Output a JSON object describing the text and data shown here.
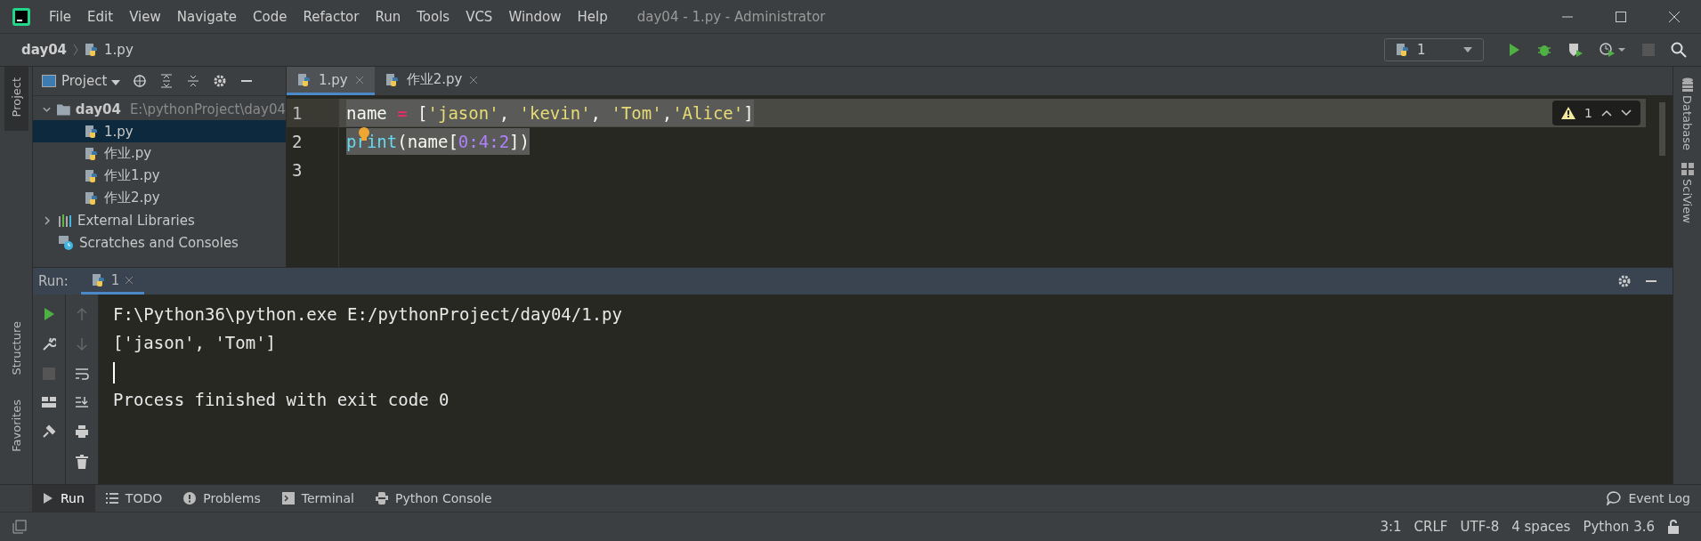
{
  "window": {
    "title": "day04 - 1.py - Administrator"
  },
  "menu": [
    "File",
    "Edit",
    "View",
    "Navigate",
    "Code",
    "Refactor",
    "Run",
    "Tools",
    "VCS",
    "Window",
    "Help"
  ],
  "breadcrumb": [
    "day04",
    "1.py"
  ],
  "run_config": {
    "label": "1"
  },
  "left_tool_windows": {
    "top": [
      {
        "label": "Project",
        "selected": true
      }
    ],
    "bottom": [
      {
        "label": "Structure",
        "selected": false
      },
      {
        "label": "Favorites",
        "selected": false
      }
    ]
  },
  "right_tool_windows": [
    "Database",
    "SciView"
  ],
  "project_panel": {
    "title": "Project",
    "tree": [
      {
        "label": "day04",
        "path": "E:\\pythonProject\\day04",
        "kind": "folder",
        "expanded": true,
        "selected": false,
        "children": [
          {
            "label": "1.py",
            "kind": "python",
            "selected": true
          },
          {
            "label": "作业.py",
            "kind": "python",
            "selected": false
          },
          {
            "label": "作业1.py",
            "kind": "python",
            "selected": false
          },
          {
            "label": "作业2.py",
            "kind": "python",
            "selected": false
          }
        ]
      },
      {
        "label": "External Libraries",
        "kind": "libraries",
        "expanded": false,
        "selected": false
      },
      {
        "label": "Scratches and Consoles",
        "kind": "scratches",
        "selected": false
      }
    ]
  },
  "editor": {
    "tabs": [
      {
        "label": "1.py",
        "selected": true
      },
      {
        "label": "作业2.py",
        "selected": false
      }
    ],
    "warnings": "1",
    "lines": [
      {
        "number": "1",
        "selected": true,
        "tokens": [
          {
            "kind": "name",
            "text": "name "
          },
          {
            "kind": "op",
            "text": "="
          },
          {
            "kind": "punct",
            "text": " ["
          },
          {
            "kind": "string",
            "text": "'jason'"
          },
          {
            "kind": "punct",
            "text": ", "
          },
          {
            "kind": "string",
            "text": "'kevin'"
          },
          {
            "kind": "punct",
            "text": ", "
          },
          {
            "kind": "string",
            "text": "'Tom'"
          },
          {
            "kind": "punct",
            "text": ","
          },
          {
            "kind": "string",
            "text": "'Alice'"
          },
          {
            "kind": "punct",
            "text": "]"
          }
        ]
      },
      {
        "number": "2",
        "selected": true,
        "tokens": [
          {
            "kind": "builtin",
            "text": "print"
          },
          {
            "kind": "punct",
            "text": "(name["
          },
          {
            "kind": "number",
            "text": "0"
          },
          {
            "kind": "number",
            "text": ":"
          },
          {
            "kind": "number",
            "text": "4"
          },
          {
            "kind": "number",
            "text": ":"
          },
          {
            "kind": "number",
            "text": "2"
          },
          {
            "kind": "punct",
            "text": "])"
          }
        ]
      },
      {
        "number": "3"
      }
    ]
  },
  "run_panel": {
    "label": "Run:",
    "tabs": [
      {
        "label": "1",
        "selected": true
      }
    ],
    "output": [
      {
        "kind": "text",
        "text": "F:\\Python36\\python.exe E:/pythonProject/day04/1.py"
      },
      {
        "kind": "text",
        "text": "['jason', 'Tom']"
      },
      {
        "kind": "cursor"
      },
      {
        "kind": "text",
        "text": "Process finished with exit code 0"
      }
    ]
  },
  "bottom_tabs": [
    {
      "label": "Run",
      "kind": "run",
      "selected": true
    },
    {
      "label": "TODO",
      "kind": "todo",
      "selected": false
    },
    {
      "label": "Problems",
      "kind": "problems",
      "selected": false
    },
    {
      "label": "Terminal",
      "kind": "terminal",
      "selected": false
    },
    {
      "label": "Python Console",
      "kind": "python",
      "selected": false
    }
  ],
  "event_log": "Event Log",
  "status_bar": [
    "3:1",
    "CRLF",
    "UTF-8",
    "4 spaces",
    "Python 3.6"
  ]
}
